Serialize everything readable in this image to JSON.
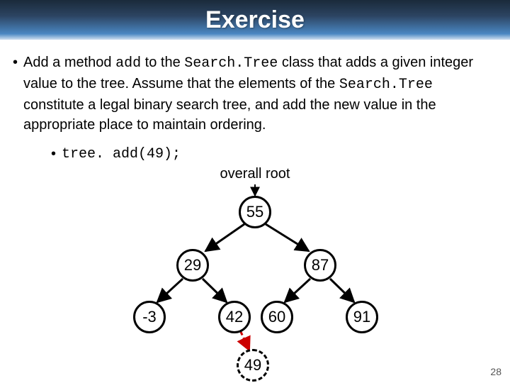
{
  "title": "Exercise",
  "bullet": {
    "prefix": "Add a method ",
    "code1": "add",
    "mid1": " to the ",
    "code2": "Search.Tree",
    "mid2": " class that adds a given integer value to the tree.  Assume that the elements of the ",
    "code3": "Search.Tree",
    "mid3": " constitute a legal binary search tree, and add the new value in the appropriate place to maintain ordering."
  },
  "sub_bullet_code": "tree. add(49);",
  "root_label": "overall root",
  "nodes": {
    "n55": "55",
    "n29": "29",
    "n87": "87",
    "nm3": "-3",
    "n42": "42",
    "n60": "60",
    "n91": "91",
    "n49": "49"
  },
  "page_number": "28",
  "chart_data": {
    "type": "tree",
    "description": "Binary search tree with root 55",
    "root": 55,
    "edges": [
      [
        55,
        29
      ],
      [
        55,
        87
      ],
      [
        29,
        -3
      ],
      [
        29,
        42
      ],
      [
        87,
        60
      ],
      [
        87,
        91
      ]
    ],
    "inserted_node": 49,
    "inserted_parent": 42,
    "inserted_side": "right"
  }
}
